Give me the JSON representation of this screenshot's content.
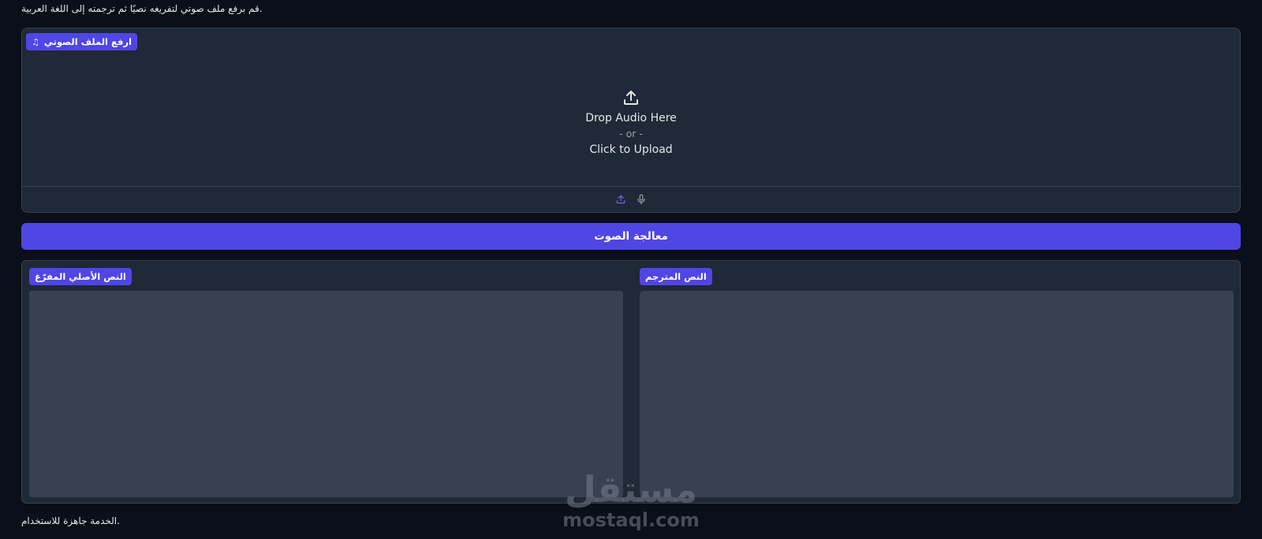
{
  "description": "قم برفع ملف صوتي لتفريغه نصيًا ثم ترجمته إلى اللغة العربية.",
  "upload": {
    "label": "ارفع الملف الصوتي",
    "label_icon": "music-note-icon",
    "drop_text": "Drop Audio Here",
    "or_text": "- or -",
    "click_text": "Click to Upload",
    "sources": [
      {
        "name": "upload",
        "icon": "upload-icon",
        "active": true
      },
      {
        "name": "microphone",
        "icon": "microphone-icon",
        "active": false
      }
    ]
  },
  "process_button": {
    "label": "معالجة الصوت"
  },
  "outputs": {
    "original": {
      "label": "النص الأصلي المفرّغ",
      "value": ""
    },
    "translated": {
      "label": "النص المترجم",
      "value": ""
    }
  },
  "status": "الخدمة جاهزة للاستخدام.",
  "watermark": {
    "arabic": "مستقل",
    "latin": "mostaql.com"
  },
  "colors": {
    "background": "#0b0f19",
    "panel": "#1f2937",
    "textbox": "#374151",
    "accent": "#4f46e5"
  }
}
